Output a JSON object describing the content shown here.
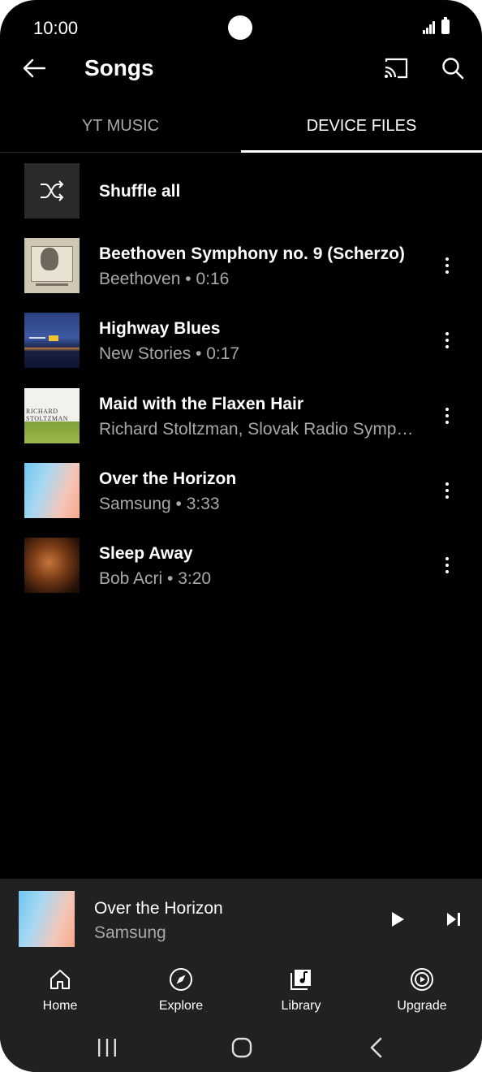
{
  "status_bar": {
    "time": "10:00"
  },
  "app_bar": {
    "title": "Songs",
    "icons": [
      "arrow-back-icon",
      "cast-icon",
      "search-icon"
    ]
  },
  "tabs": [
    {
      "label": "YT MUSIC",
      "selected": false
    },
    {
      "label": "DEVICE FILES",
      "selected": true
    }
  ],
  "shuffle": {
    "label": "Shuffle all",
    "icon": "shuffle-icon"
  },
  "songs": [
    {
      "title": "Beethoven Symphony no. 9 (Scherzo)",
      "subtitle": "Beethoven • 0:16"
    },
    {
      "title": "Highway Blues",
      "subtitle": "New Stories • 0:17"
    },
    {
      "title": "Maid with the Flaxen Hair",
      "subtitle": "Richard Stoltzman, Slovak Radio Symp…"
    },
    {
      "title": "Over the Horizon",
      "subtitle": "Samsung • 3:33"
    },
    {
      "title": "Sleep Away",
      "subtitle": "Bob Acri • 3:20"
    }
  ],
  "album_art_text": {
    "richard_line1": "RICHARD",
    "richard_line2": "STOLTZMAN"
  },
  "mini_player": {
    "title": "Over the Horizon",
    "artist": "Samsung",
    "icons": [
      "play-icon",
      "skip-next-icon"
    ]
  },
  "bottom_nav": [
    {
      "label": "Home",
      "icon": "home-icon"
    },
    {
      "label": "Explore",
      "icon": "compass-icon"
    },
    {
      "label": "Library",
      "icon": "library-music-icon"
    },
    {
      "label": "Upgrade",
      "icon": "upgrade-play-icon"
    }
  ],
  "system_nav": {
    "icons": [
      "recent-apps-icon",
      "home-circle-icon",
      "system-back-icon"
    ]
  },
  "colors": {
    "background": "#000000",
    "surface": "#212121",
    "primary_text": "#ffffff",
    "secondary_text": "#a8a8a8"
  }
}
